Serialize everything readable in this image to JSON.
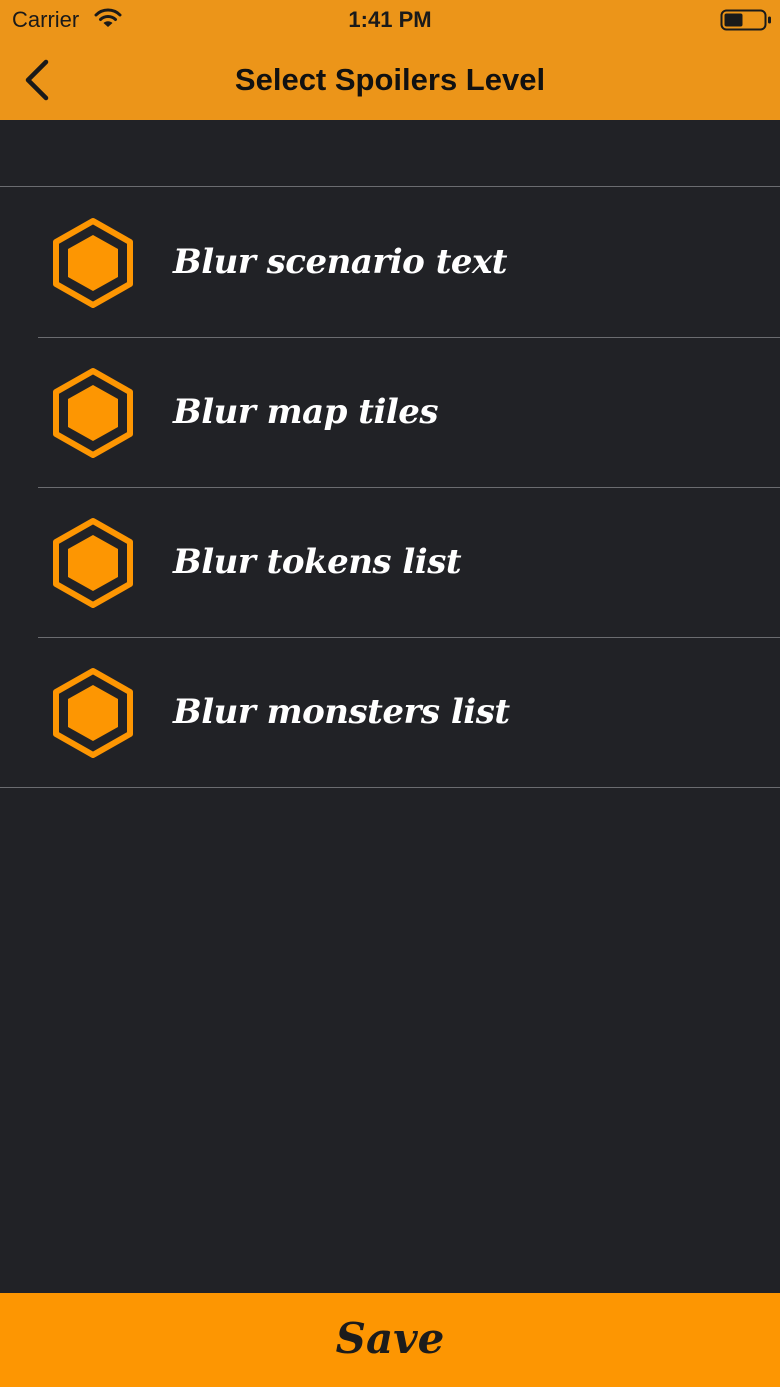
{
  "status_bar": {
    "carrier": "Carrier",
    "time": "1:41 PM",
    "wifi_icon": "wifi-icon",
    "battery_icon": "battery-icon"
  },
  "nav": {
    "title": "Select Spoilers Level",
    "back_icon": "chevron-left-icon"
  },
  "options": [
    {
      "label": "Blur scenario text",
      "icon": "hexagon-icon"
    },
    {
      "label": "Blur map tiles",
      "icon": "hexagon-icon"
    },
    {
      "label": "Blur tokens list",
      "icon": "hexagon-icon"
    },
    {
      "label": "Blur monsters list",
      "icon": "hexagon-icon"
    }
  ],
  "save_button": {
    "label": "Save"
  },
  "colors": {
    "header": "#ec9519",
    "background": "#212226",
    "accent": "#fd9602",
    "divider": "#6b6c70",
    "text": "#ffffff"
  }
}
